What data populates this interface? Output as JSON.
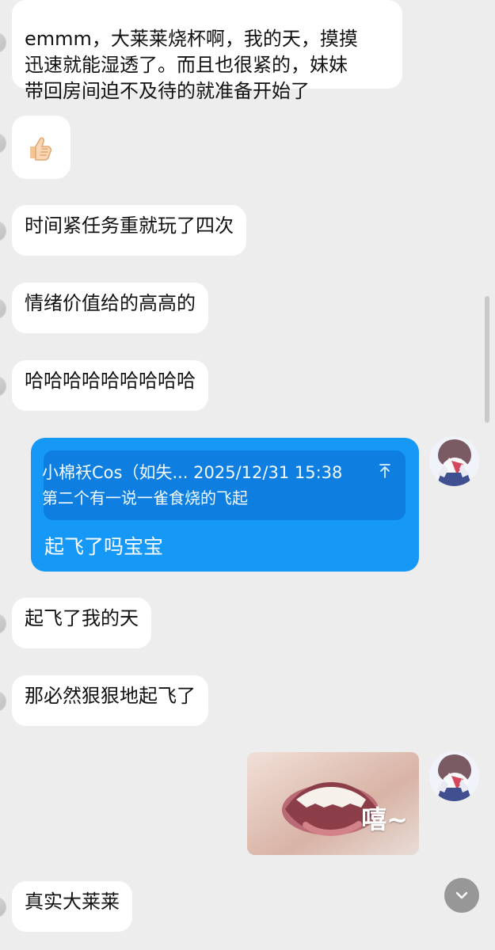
{
  "conversation": {
    "messages": {
      "first_text": "emmm，大莱莱烧杯啊，我的天，摸摸\n迅速就能湿透了。而且也很紧的，妹妹\n带回房间迫不及待的就准备开始了",
      "thumb_icon": "thumb-up-icon",
      "time_text": "时间紧任务重就玩了四次",
      "emotion_text": "情绪价值给的高高的",
      "laugh_text": "哈哈哈哈哈哈哈哈哈",
      "reply_header": "小棉袄Cos（如失... 2025/12/31 15:38",
      "reply_quote": "第二个有一说一雀食烧的飞起",
      "reply_text": "起飞了吗宝宝",
      "flying_text": "起飞了我的天",
      "certain_text": "那必然狠狠地起飞了",
      "sticker_caption": "嘻~",
      "final_text": "真实大莱莱"
    }
  },
  "ui": {
    "colors": {
      "background": "#ededed",
      "incoming_bubble": "#ffffff",
      "outgoing_bubble": "#1698f7",
      "quote_box": "#0e7ee1",
      "text_dark": "#111111",
      "text_light": "#ffffff"
    },
    "icons": {
      "quote": "quote-up-icon",
      "scroll_down": "chevron-down-icon",
      "self_avatar": "anime-avatar-icon",
      "photo": "smiling-photo-icon"
    }
  }
}
